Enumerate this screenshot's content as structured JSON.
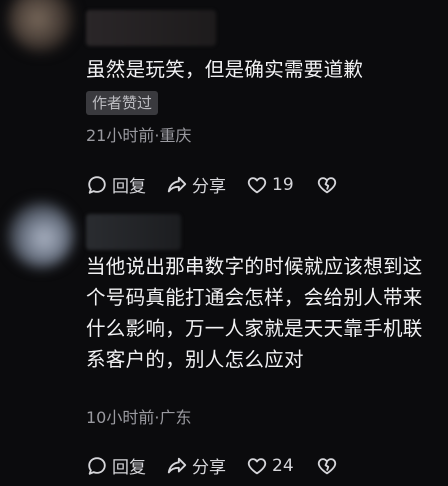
{
  "comments": [
    {
      "text": "虽然是玩笑，但是确实需要道歉",
      "badge": "作者赞过",
      "meta": "21小时前·重庆",
      "reply_label": "回复",
      "share_label": "分享",
      "like_count": "19"
    },
    {
      "text": "当他说出那串数字的时候就应该想到这个号码真能打通会怎样，会给别人带来什么影响，万一人家就是天天靠手机联系客户的，别人怎么应对",
      "meta": "10小时前·广东",
      "reply_label": "回复",
      "share_label": "分享",
      "like_count": "24"
    }
  ],
  "icons": {
    "reply": "chat-bubble-icon",
    "share": "share-arrow-icon",
    "like": "heart-icon",
    "dislike": "broken-heart-icon"
  }
}
